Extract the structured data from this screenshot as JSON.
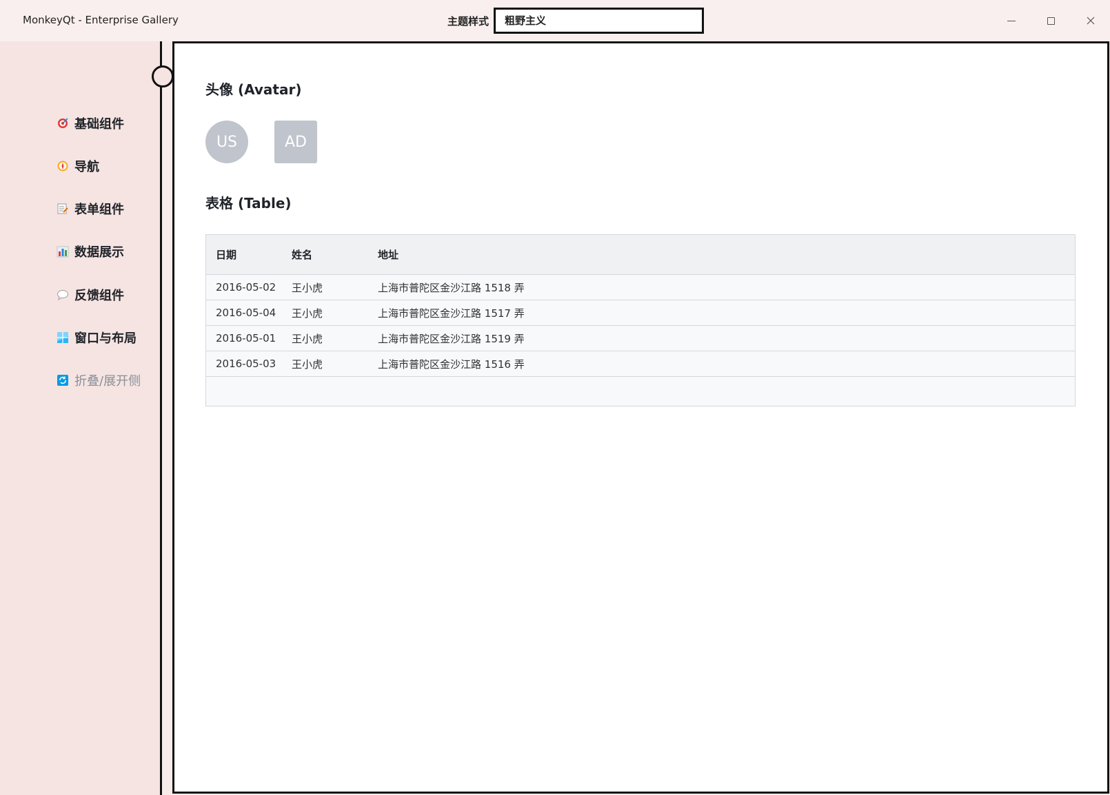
{
  "window": {
    "title": "MonkeyQt - Enterprise Gallery",
    "theme_label": "主题样式",
    "theme_value": "粗野主义"
  },
  "sidebar": {
    "items": [
      {
        "label": "基础组件",
        "icon": "target-icon"
      },
      {
        "label": "导航",
        "icon": "compass-icon"
      },
      {
        "label": "表单组件",
        "icon": "memo-icon"
      },
      {
        "label": "数据展示",
        "icon": "bar-chart-icon"
      },
      {
        "label": "反馈组件",
        "icon": "speech-bubble-icon"
      },
      {
        "label": "窗口与布局",
        "icon": "window-icon"
      },
      {
        "label": "折叠/展开侧",
        "icon": "refresh-icon"
      }
    ]
  },
  "main": {
    "avatar_title": "头像 (Avatar)",
    "avatars": [
      "US",
      "AD"
    ],
    "table_title": "表格 (Table)",
    "table": {
      "headers": [
        "日期",
        "姓名",
        "地址"
      ],
      "rows": [
        [
          "2016-05-02",
          "王小虎",
          "上海市普陀区金沙江路 1518 弄"
        ],
        [
          "2016-05-04",
          "王小虎",
          "上海市普陀区金沙江路 1517 弄"
        ],
        [
          "2016-05-01",
          "王小虎",
          "上海市普陀区金沙江路 1519 弄"
        ],
        [
          "2016-05-03",
          "王小虎",
          "上海市普陀区金沙江路 1516 弄"
        ]
      ]
    }
  },
  "colors": {
    "titlebar_bg": "#f9efee",
    "sidebar_bg": "#f5e4e2",
    "avatar_bg": "#c0c4cc",
    "table_header_bg": "#f0f1f3",
    "border": "#111111"
  }
}
